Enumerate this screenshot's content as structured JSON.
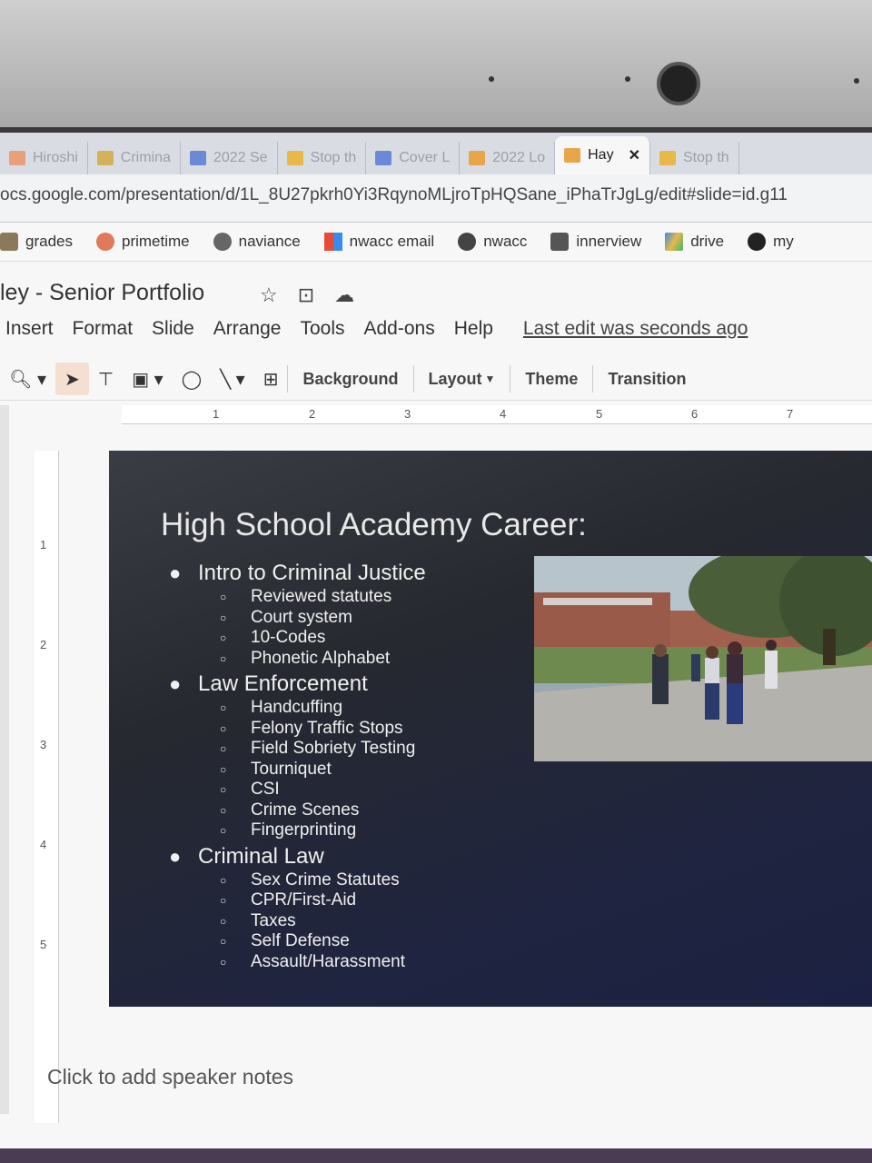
{
  "tabs": [
    {
      "label": "Hiroshi",
      "color": "#e8a07c",
      "active": false
    },
    {
      "label": "Crimina",
      "color": "#d4b25a",
      "active": false
    },
    {
      "label": "2022 Se",
      "color": "#6a8ad8",
      "active": false
    },
    {
      "label": "Stop th",
      "color": "#e8b84a",
      "active": false
    },
    {
      "label": "Cover L",
      "color": "#6a8ad8",
      "active": false
    },
    {
      "label": "2022 Lo",
      "color": "#e8a64a",
      "active": false
    },
    {
      "label": "Hay",
      "color": "#e8a64a",
      "active": true
    },
    {
      "label": "Stop th",
      "color": "#e8b84a",
      "active": false
    }
  ],
  "url": "ocs.google.com/presentation/d/1L_8U27pkrh0Yi3RqynoMLjroTpHQSane_iPhaTrJgLg/edit#slide=id.g11",
  "bookmarks": [
    "grades",
    "primetime",
    "naviance",
    "nwacc email",
    "nwacc",
    "innerview",
    "drive",
    "my"
  ],
  "doc_title": "ley - Senior Portfolio",
  "menu": [
    "Insert",
    "Format",
    "Slide",
    "Arrange",
    "Tools",
    "Add-ons",
    "Help"
  ],
  "last_edit": "Last edit was seconds ago",
  "toolbar": {
    "background": "Background",
    "layout": "Layout",
    "theme": "Theme",
    "transition": "Transition"
  },
  "ruler_h": [
    "1",
    "2",
    "3",
    "4",
    "5",
    "6",
    "7"
  ],
  "ruler_v": [
    "1",
    "2",
    "3",
    "4",
    "5"
  ],
  "slide": {
    "title": "High School Academy Career:",
    "sections": [
      {
        "heading": "Intro to Criminal Justice",
        "items": [
          "Reviewed statutes",
          "Court system",
          "10-Codes",
          "Phonetic Alphabet"
        ]
      },
      {
        "heading": "Law Enforcement",
        "items": [
          "Handcuffing",
          "Felony Traffic Stops",
          "Field Sobriety Testing",
          "Tourniquet",
          "CSI",
          "Crime Scenes",
          "Fingerprinting"
        ]
      },
      {
        "heading": "Criminal Law",
        "items": [
          "Sex Crime Statutes",
          "CPR/First-Aid",
          "Taxes",
          "Self Defense",
          "Assault/Harassment"
        ]
      }
    ]
  },
  "speaker_notes": "Click to add speaker notes"
}
